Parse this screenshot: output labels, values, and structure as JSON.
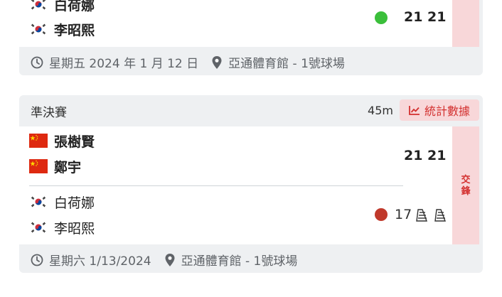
{
  "match1": {
    "team_a": [
      {
        "name": "白荷娜",
        "flag": "south-korea-flag"
      },
      {
        "name": "李昭熙",
        "flag": "south-korea-flag"
      }
    ],
    "score": "21 21",
    "status_color": "#3bbf3b",
    "date": "星期五 2024 年 1 月 12 日",
    "venue": "亞通體育館 - 1號球場"
  },
  "match2": {
    "round": "準決賽",
    "duration": "45m",
    "stats_label": "統計數據",
    "team_a": [
      {
        "name": "張樹賢",
        "flag": "china-flag"
      },
      {
        "name": "鄭宇",
        "flag": "china-flag"
      }
    ],
    "team_a_score": "21 21",
    "team_b": [
      {
        "name": "白荷娜",
        "flag": "south-korea-flag"
      },
      {
        "name": "李昭熙",
        "flag": "south-korea-flag"
      }
    ],
    "team_b_score": "17",
    "status_color": "#c0392b",
    "side_label_1": "交",
    "side_label_2": "鋒",
    "date": "星期六 1/13/2024",
    "venue": "亞通體育館 - 1號球場"
  },
  "colors": {
    "accent_red": "#d3302f",
    "strip_pink": "#f8d7d9",
    "card_grey": "#eef0f2"
  }
}
